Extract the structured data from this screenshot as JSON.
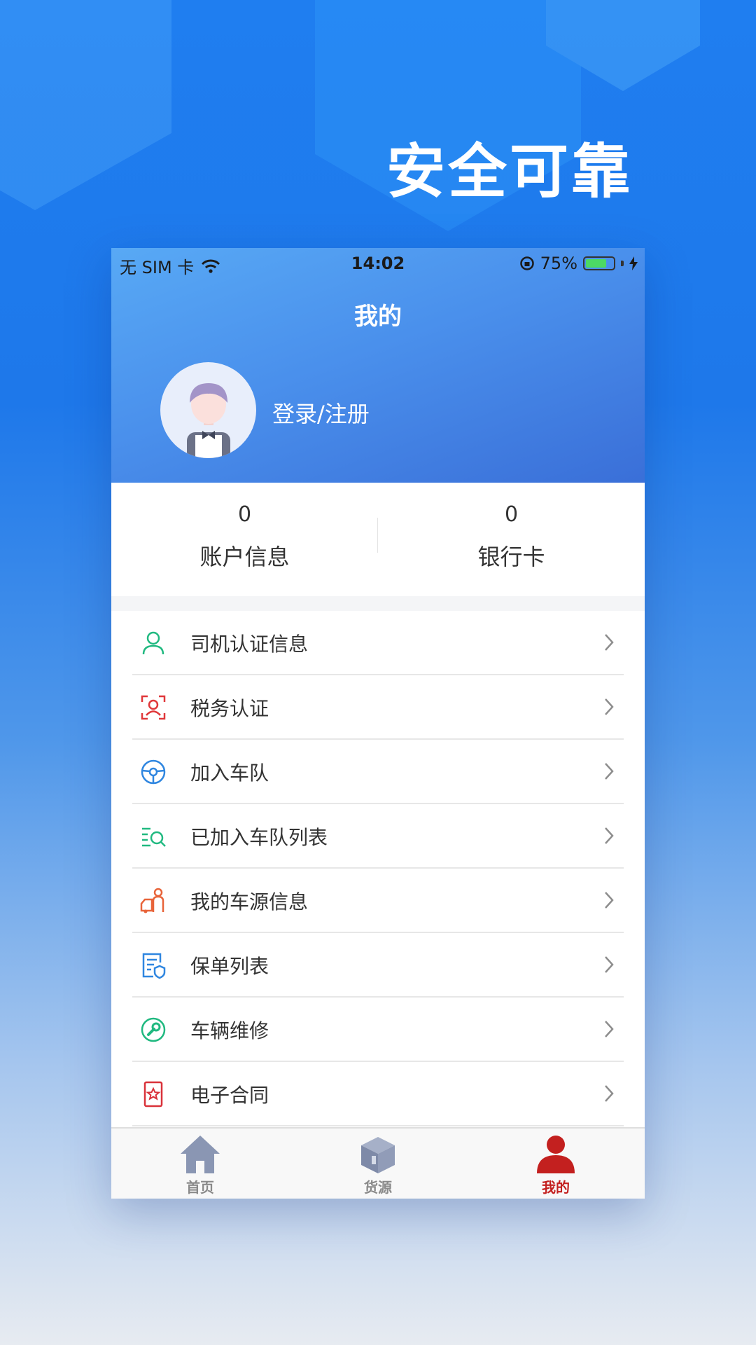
{
  "promo": {
    "headline": "安全可靠"
  },
  "status_bar": {
    "carrier": "无 SIM 卡",
    "wifi_icon": "wifi-icon",
    "time": "14:02",
    "battery_percent": "75%",
    "battery_level": 0.75,
    "battery_color": "#4cd964"
  },
  "header": {
    "title": "我的",
    "login_label": "登录/注册"
  },
  "stats": [
    {
      "value": "0",
      "label": "账户信息"
    },
    {
      "value": "0",
      "label": "银行卡"
    }
  ],
  "menu": [
    {
      "label": "司机认证信息",
      "icon": "person-icon",
      "color": "#20b980"
    },
    {
      "label": "税务认证",
      "icon": "face-scan-icon",
      "color": "#e0383a"
    },
    {
      "label": "加入车队",
      "icon": "steering-wheel-icon",
      "color": "#2f86e0"
    },
    {
      "label": "已加入车队列表",
      "icon": "list-search-icon",
      "color": "#20b980"
    },
    {
      "label": "我的车源信息",
      "icon": "driver-car-icon",
      "color": "#e8643a"
    },
    {
      "label": "保单列表",
      "icon": "policy-shield-icon",
      "color": "#2f86e0"
    },
    {
      "label": "车辆维修",
      "icon": "wrench-icon",
      "color": "#20b980"
    },
    {
      "label": "电子合同",
      "icon": "contract-star-icon",
      "color": "#d9323a"
    }
  ],
  "tabs": [
    {
      "label": "首页",
      "icon": "home-icon",
      "active": false
    },
    {
      "label": "货源",
      "icon": "box-icon",
      "active": false
    },
    {
      "label": "我的",
      "icon": "user-icon",
      "active": true
    }
  ],
  "colors": {
    "accent": "#c3201f",
    "header_gradient_start": "#58a9f5",
    "header_gradient_end": "#3a6fd8"
  }
}
